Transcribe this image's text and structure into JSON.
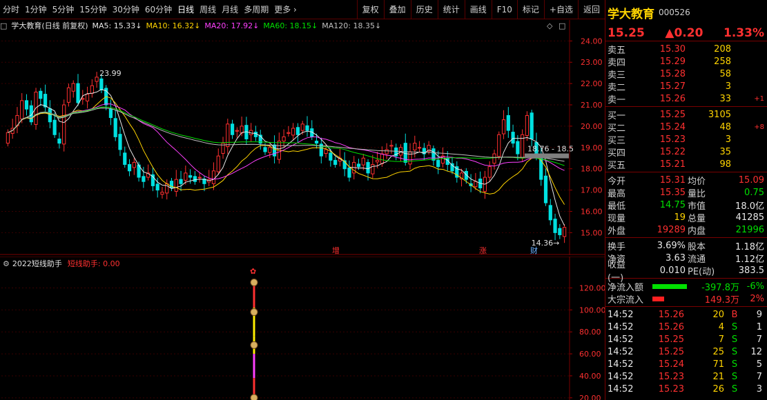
{
  "toolbar": {
    "left": [
      "分时",
      "1分钟",
      "5分钟",
      "15分钟",
      "30分钟",
      "60分钟",
      "日线",
      "周线",
      "月线",
      "多周期",
      "更多 ›"
    ],
    "active": "日线",
    "right": [
      "复权",
      "叠加",
      "历史",
      "统计",
      "画线",
      "F10",
      "标记",
      "+自选",
      "返回"
    ]
  },
  "chart_header": {
    "title": "学大教育(日线 前复权)",
    "ma": [
      {
        "label": "MA5: 15.33↓",
        "color": "#e8e8e8"
      },
      {
        "label": "MA10: 16.32↓",
        "color": "#ffd400"
      },
      {
        "label": "MA20: 17.92↓",
        "color": "#ff40ff"
      },
      {
        "label": "MA60: 18.15↓",
        "color": "#00e000"
      },
      {
        "label": "MA120: 18.35↓",
        "color": "#c0c0c0"
      }
    ]
  },
  "chart_data": [
    {
      "type": "candlestick",
      "title": "学大教育(日线 前复权)",
      "ylim": [
        14.3,
        24.4
      ],
      "y_ticks": [
        15.0,
        16.0,
        17.0,
        18.0,
        19.0,
        20.0,
        21.0,
        22.0,
        23.0,
        24.0
      ],
      "annotations": [
        "23.99",
        "14.36",
        "18.76 - 18.5",
        "增",
        "涨",
        "财"
      ],
      "series": [
        {
          "name": "MA5",
          "color": "#e8e8e8",
          "last": 15.33
        },
        {
          "name": "MA10",
          "color": "#ffd400",
          "last": 16.32
        },
        {
          "name": "MA20",
          "color": "#ff40ff",
          "last": 17.92
        },
        {
          "name": "MA60",
          "color": "#00e000",
          "last": 18.15
        },
        {
          "name": "MA120",
          "color": "#c0c0c0",
          "last": 18.35
        }
      ],
      "closes": [
        19.7,
        19.9,
        20.5,
        21.2,
        20.8,
        20.2,
        21.6,
        21.3,
        20.9,
        20.2,
        19.6,
        19.2,
        21.0,
        21.8,
        22.0,
        21.1,
        21.3,
        21.5,
        21.9,
        22.3,
        21.7,
        21.0,
        20.4,
        19.5,
        18.9,
        18.2,
        17.9,
        18.3,
        17.6,
        17.4,
        17.8,
        17.2,
        17.0,
        16.9,
        17.3,
        17.1,
        17.5,
        17.3,
        17.8,
        17.6,
        17.4,
        17.6,
        17.3,
        17.5,
        17.9,
        18.6,
        19.2,
        20.1,
        19.6,
        19.8,
        20.0,
        19.4,
        19.8,
        19.5,
        19.2,
        18.8,
        19.0,
        18.6,
        19.3,
        19.5,
        19.7,
        19.9,
        19.6,
        20.1,
        19.8,
        19.5,
        19.2,
        18.6,
        18.9,
        18.4,
        18.2,
        18.5,
        18.0,
        17.6,
        18.3,
        18.1,
        18.5,
        17.8,
        18.2,
        18.4,
        18.7,
        18.9,
        19.1,
        18.6,
        19.0,
        18.3,
        18.8,
        19.2,
        19.0,
        18.7,
        19.1,
        18.4,
        18.1,
        18.6,
        18.2,
        17.9,
        17.6,
        17.8,
        17.5,
        17.2,
        17.4,
        17.1,
        17.6,
        18.1,
        18.7,
        19.6,
        20.3,
        19.8,
        19.2,
        18.7,
        19.6,
        20.5,
        19.4,
        18.6,
        17.5,
        16.4,
        15.6,
        15.0,
        14.9,
        15.25
      ],
      "last_close": 15.25
    },
    {
      "type": "line",
      "title": "2022短线助手",
      "ylim": [
        18,
        136
      ],
      "y_ticks": [
        20.0,
        40.0,
        60.0,
        80.0,
        100.0,
        120.0
      ],
      "series": [
        {
          "name": "短线助手: 0.00",
          "last": 0.0
        }
      ]
    }
  ],
  "sub_header": {
    "title": "2022短线助手",
    "indicator": "短线助手: 0.00"
  },
  "panel": {
    "name": "学大教育",
    "code": "000526",
    "price": "15.25",
    "change": "▲0.20",
    "change_pct": "1.33%",
    "asks": [
      {
        "label": "卖五",
        "price": "15.30",
        "vol": "208",
        "chg": ""
      },
      {
        "label": "卖四",
        "price": "15.29",
        "vol": "258",
        "chg": ""
      },
      {
        "label": "卖三",
        "price": "15.28",
        "vol": "58",
        "chg": ""
      },
      {
        "label": "卖二",
        "price": "15.27",
        "vol": "3",
        "chg": ""
      },
      {
        "label": "卖一",
        "price": "15.26",
        "vol": "33",
        "chg": "+1"
      }
    ],
    "bids": [
      {
        "label": "买一",
        "price": "15.25",
        "vol": "3105",
        "chg": ""
      },
      {
        "label": "买二",
        "price": "15.24",
        "vol": "48",
        "chg": "+8"
      },
      {
        "label": "买三",
        "price": "15.23",
        "vol": "3",
        "chg": ""
      },
      {
        "label": "买四",
        "price": "15.22",
        "vol": "35",
        "chg": ""
      },
      {
        "label": "买五",
        "price": "15.21",
        "vol": "98",
        "chg": ""
      }
    ],
    "stats": [
      {
        "l1": "今开",
        "v1": "15.31",
        "c1": "red",
        "l2": "均价",
        "v2": "15.09",
        "c2": "red"
      },
      {
        "l1": "最高",
        "v1": "15.35",
        "c1": "red",
        "l2": "量比",
        "v2": "0.75",
        "c2": "green"
      },
      {
        "l1": "最低",
        "v1": "14.75",
        "c1": "green",
        "l2": "市值",
        "v2": "18.0亿",
        "c2": "white"
      },
      {
        "l1": "现量",
        "v1": "19",
        "c1": "yellow",
        "l2": "总量",
        "v2": "41285",
        "c2": "white"
      },
      {
        "l1": "外盘",
        "v1": "19289",
        "c1": "red",
        "l2": "内盘",
        "v2": "21996",
        "c2": "green"
      }
    ],
    "stats2": [
      {
        "l1": "换手",
        "v1": "3.69%",
        "c1": "white",
        "l2": "股本",
        "v2": "1.18亿",
        "c2": "white"
      },
      {
        "l1": "净资",
        "v1": "3.63",
        "c1": "white",
        "l2": "流通",
        "v2": "1.12亿",
        "c2": "white"
      },
      {
        "l1": "收益(一)",
        "v1": "0.010",
        "c1": "white",
        "l2": "PE(动)",
        "v2": "383.5",
        "c2": "white"
      }
    ],
    "flows": [
      {
        "label": "净流入额",
        "value": "-397.8万",
        "pct": "-6%",
        "color": "#00e000",
        "level": 0.9,
        "vcolor": "green"
      },
      {
        "label": "大宗流入",
        "value": "149.3万",
        "pct": "2%",
        "color": "#ff2020",
        "level": 0.3,
        "vcolor": "red"
      }
    ],
    "ticks": [
      {
        "time": "14:52",
        "price": "15.26",
        "vol": "20",
        "dir": "B",
        "n": "9"
      },
      {
        "time": "14:52",
        "price": "15.26",
        "vol": "4",
        "dir": "S",
        "n": "1"
      },
      {
        "time": "14:52",
        "price": "15.25",
        "vol": "7",
        "dir": "S",
        "n": "7"
      },
      {
        "time": "14:52",
        "price": "15.25",
        "vol": "25",
        "dir": "S",
        "n": "12"
      },
      {
        "time": "14:52",
        "price": "15.24",
        "vol": "71",
        "dir": "S",
        "n": "5"
      },
      {
        "time": "14:52",
        "price": "15.23",
        "vol": "21",
        "dir": "S",
        "n": "7"
      },
      {
        "time": "14:52",
        "price": "15.23",
        "vol": "26",
        "dir": "S",
        "n": "3"
      }
    ]
  }
}
